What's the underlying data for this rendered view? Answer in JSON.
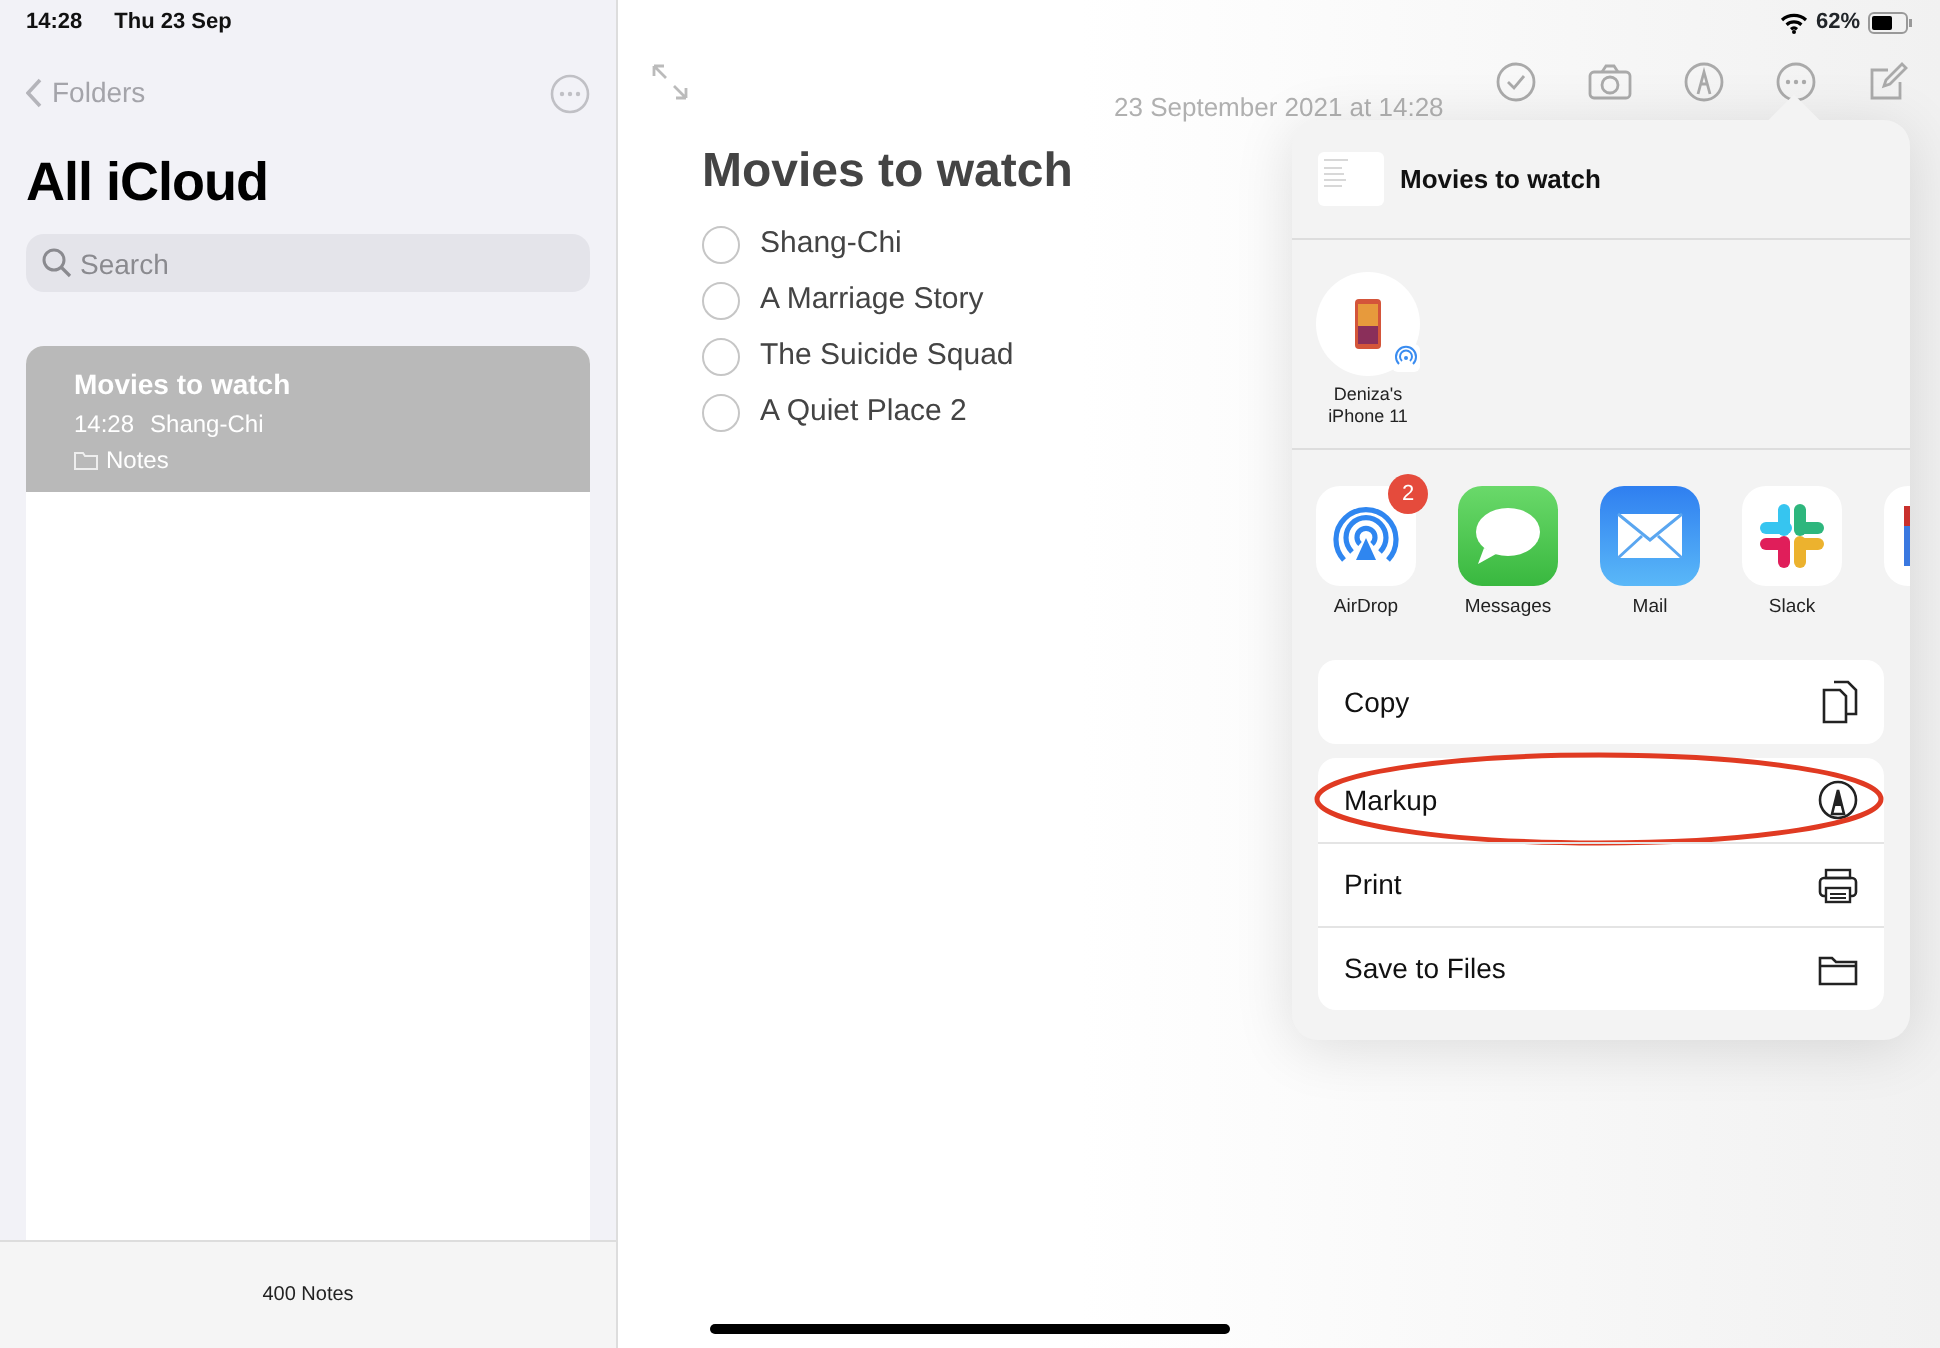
{
  "status_bar": {
    "time": "14:28",
    "date": "Thu 23 Sep",
    "battery": "62%"
  },
  "sidebar": {
    "back_label": "Folders",
    "title": "All iCloud",
    "search": {
      "placeholder": "Search"
    },
    "notes": [
      {
        "title": "Movies to watch",
        "time": "14:28",
        "preview": "Shang-Chi",
        "folder": "Notes",
        "selected": true
      }
    ],
    "footer": "400 Notes"
  },
  "note": {
    "date": "23 September 2021 at 14:28",
    "title": "Movies to watch",
    "checklist": [
      {
        "text": "Shang-Chi",
        "checked": false
      },
      {
        "text": "A Marriage Story",
        "checked": false
      },
      {
        "text": "The Suicide Squad",
        "checked": false
      },
      {
        "text": "A Quiet Place 2",
        "checked": false
      }
    ]
  },
  "share_sheet": {
    "title": "Movies to watch",
    "people": [
      {
        "name": "Deniza's iPhone 11"
      }
    ],
    "apps": [
      {
        "kind": "airdrop",
        "name": "AirDrop",
        "badge": "2"
      },
      {
        "kind": "messages",
        "name": "Messages"
      },
      {
        "kind": "mail",
        "name": "Mail"
      },
      {
        "kind": "slack",
        "name": "Slack"
      },
      {
        "kind": "docs"
      }
    ],
    "action_groups": [
      [
        {
          "label": "Copy",
          "kind": "copy",
          "circled": false
        }
      ],
      [
        {
          "label": "Markup",
          "kind": "markup",
          "circled": true
        },
        {
          "label": "Print",
          "kind": "print",
          "circled": false
        },
        {
          "label": "Save to Files",
          "kind": "files",
          "circled": false
        }
      ]
    ]
  }
}
